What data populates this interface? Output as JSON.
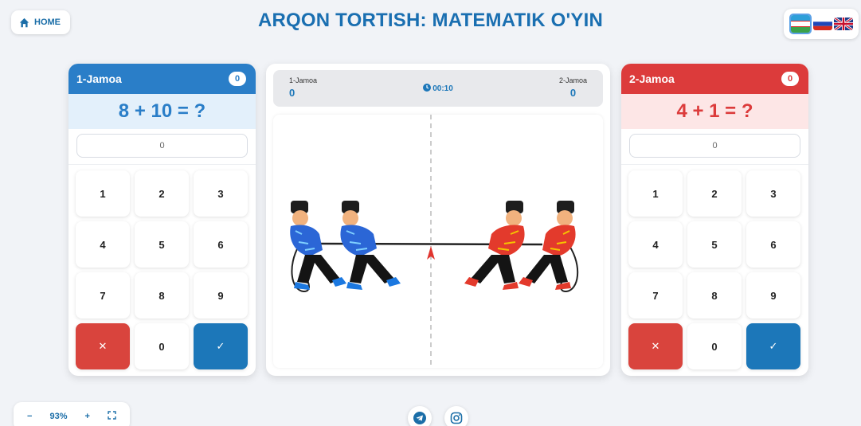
{
  "header": {
    "home_label": "HOME",
    "title": "ARQON TORTISH: MATEMATIK O'YIN"
  },
  "languages": [
    "uz",
    "ru",
    "en"
  ],
  "teams": [
    {
      "name": "1-Jamoa",
      "score": "0",
      "question": "8 + 10 = ?",
      "answer_placeholder": "0",
      "color": "#2a7ec8"
    },
    {
      "name": "2-Jamoa",
      "score": "0",
      "question": "4 + 1 = ?",
      "answer_placeholder": "0",
      "color": "#dc3b3b"
    }
  ],
  "keypad": {
    "keys": [
      "1",
      "2",
      "3",
      "4",
      "5",
      "6",
      "7",
      "8",
      "9"
    ],
    "zero": "0",
    "cancel_glyph": "✕",
    "ok_glyph": "✓"
  },
  "scoreboard": {
    "team1_name": "1-Jamoa",
    "team1_score": "0",
    "team2_name": "2-Jamoa",
    "team2_score": "0",
    "timer": "00:10"
  },
  "zoom": {
    "minus": "−",
    "level": "93%",
    "plus": "+"
  },
  "social": [
    "telegram-icon",
    "instagram-icon"
  ]
}
